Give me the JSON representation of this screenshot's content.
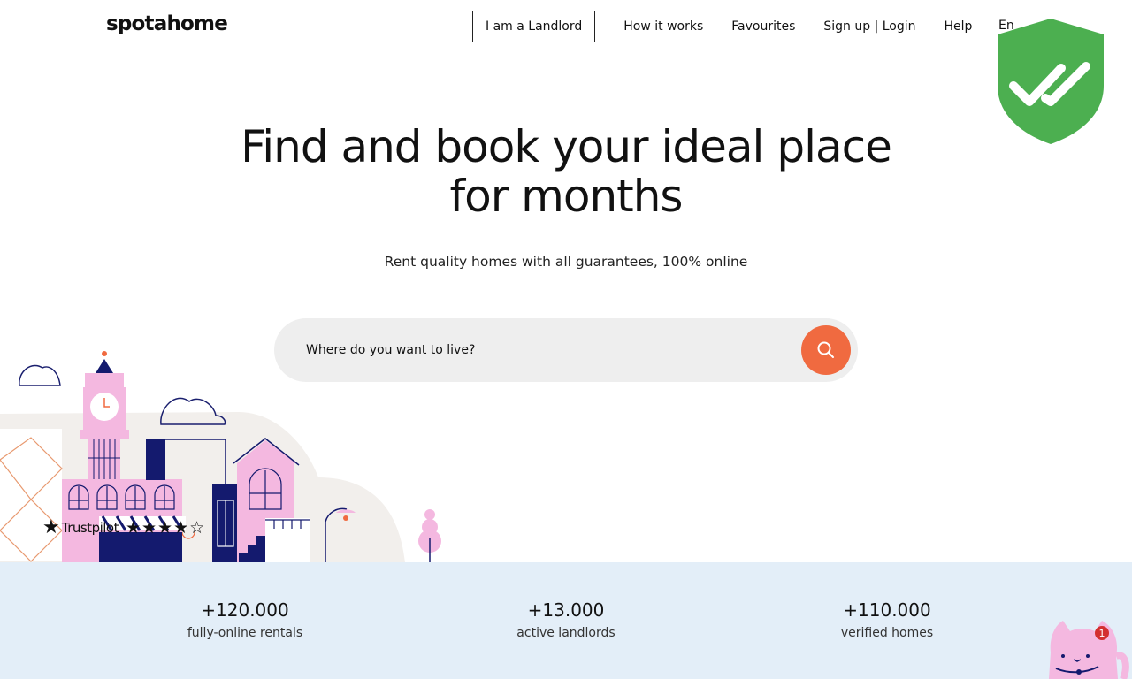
{
  "header": {
    "logo": "spotahome",
    "nav": {
      "landlord": "I am a Landlord",
      "how_it_works": "How it works",
      "favourites": "Favourites",
      "signup_login": "Sign up | Login",
      "help": "Help",
      "language": "En"
    }
  },
  "hero": {
    "title_line1": "Find and book your ideal place",
    "title_line2": "for months",
    "subtitle": "Rent quality homes with all guarantees, 100% online"
  },
  "search": {
    "placeholder": "Where do you want to live?",
    "button_icon": "search-icon"
  },
  "trustpilot": {
    "brand": "Trustpilot",
    "stars_filled": 4,
    "stars_total": 5,
    "stars_text": "★★★★☆"
  },
  "stats": [
    {
      "value": "+120.000",
      "label": "fully-online rentals"
    },
    {
      "value": "+13.000",
      "label": "active landlords"
    },
    {
      "value": "+110.000",
      "label": "verified homes"
    }
  ],
  "chat_widget": {
    "icon": "cat-chat-icon",
    "badge": "1"
  },
  "colors": {
    "accent": "#f06a40",
    "stats_bg": "#e3eef8",
    "search_bg": "#eeeeee",
    "shield": "#4caf50"
  }
}
